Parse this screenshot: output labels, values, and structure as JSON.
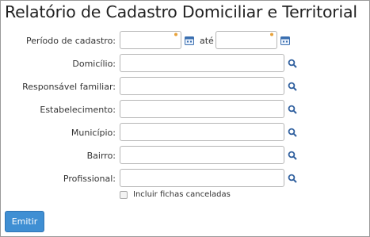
{
  "title": "Relatório de Cadastro Domiciliar e Territorial",
  "periodo": {
    "label": "Período de cadastro:",
    "separator": "até",
    "start_value": "",
    "end_value": ""
  },
  "fields": {
    "domicilio": {
      "label": "Domicílio:",
      "value": ""
    },
    "responsavel": {
      "label": "Responsável familiar:",
      "value": ""
    },
    "estabelecimento": {
      "label": "Estabelecimento:",
      "value": ""
    },
    "municipio": {
      "label": "Município:",
      "value": ""
    },
    "bairro": {
      "label": "Bairro:",
      "value": ""
    },
    "profissional": {
      "label": "Profissional:",
      "value": ""
    }
  },
  "checkbox": {
    "label": "Incluir fichas canceladas",
    "checked": false
  },
  "submit_label": "Emitir",
  "colors": {
    "accent": "#3f8fd3",
    "icon_blue": "#2f5f9e",
    "calendar_blue": "#3b6fb0",
    "pin_orange": "#e8a23a"
  },
  "icons": [
    "calendar-icon",
    "search-icon",
    "pin-icon"
  ]
}
